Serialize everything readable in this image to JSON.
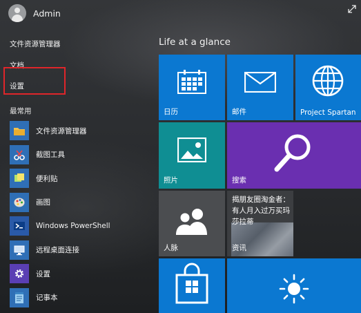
{
  "user": {
    "name": "Admin"
  },
  "nav_links": {
    "file_explorer": "文件资源管理器",
    "documents": "文档",
    "settings": "设置"
  },
  "most_used": {
    "label": "最常用",
    "items": [
      {
        "label": "文件资源管理器",
        "icon": "folder-icon"
      },
      {
        "label": "截图工具",
        "icon": "scissors-icon"
      },
      {
        "label": "便利贴",
        "icon": "sticky-note-icon"
      },
      {
        "label": "画图",
        "icon": "paint-palette-icon"
      },
      {
        "label": "Windows PowerShell",
        "icon": "powershell-icon"
      },
      {
        "label": "远程桌面连接",
        "icon": "remote-desktop-icon"
      },
      {
        "label": "设置",
        "icon": "gear-icon"
      },
      {
        "label": "记事本",
        "icon": "notepad-icon"
      }
    ]
  },
  "tiles_group": {
    "title": "Life at a glance"
  },
  "tiles": {
    "calendar": {
      "label": "日历"
    },
    "mail": {
      "label": "邮件"
    },
    "spartan": {
      "label": "Project Spartan"
    },
    "photos": {
      "label": "照片"
    },
    "search": {
      "label": "搜索"
    },
    "people": {
      "label": "人脉"
    },
    "news": {
      "label": "资讯",
      "headline": "揭朋友圈淘金者：有人月入过万买玛莎拉蒂"
    }
  },
  "colors": {
    "tile_blue": "#0b78d1",
    "tile_teal": "#0f8e93",
    "tile_purple": "#6a2fb0",
    "tile_gray": "#4b4d50",
    "app_icon_blue": "#2f6fb6",
    "settings_icon_purple": "#5a3fb4",
    "highlight_red": "#e0252a"
  }
}
